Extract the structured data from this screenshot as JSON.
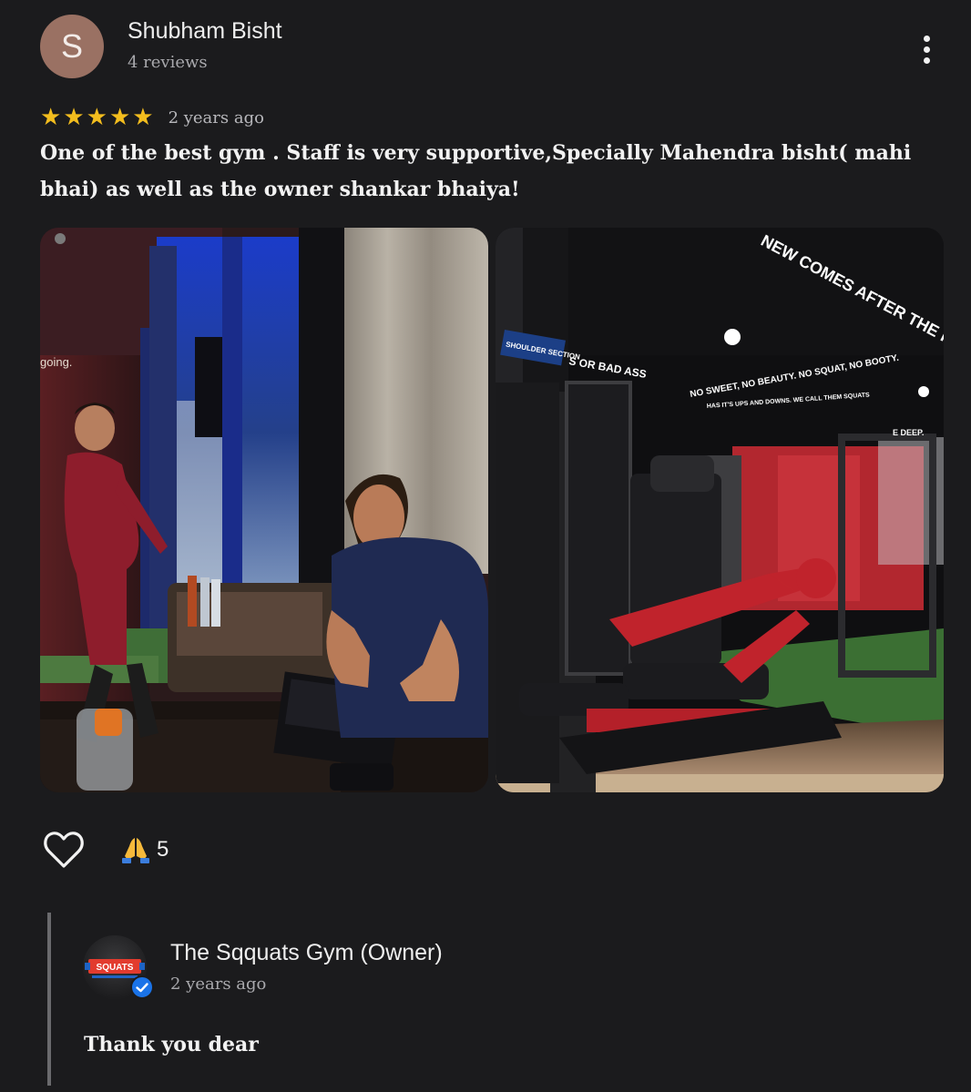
{
  "review": {
    "avatar_initial": "S",
    "avatar_color": "#9a7163",
    "reviewer_name": "Shubham Bisht",
    "reviewer_meta": "4 reviews",
    "rating": 5,
    "date": "2 years ago",
    "text": "One of the best gym .   Staff is very supportive,Specially Mahendra bisht( mahi bhai) as well as the owner shankar bhaiya!",
    "menu_icon": "more-vert-icon"
  },
  "photos": {
    "left": {
      "wall_text": "going."
    },
    "right": {
      "wall_slogan": "NEW COMES AFTER THE HARDEST CLI",
      "shoulder_sign": "SHOULDER SECTION",
      "beam_text_left": "S OR BAD ASS",
      "beam_text_main": "NO SWEET, NO BEAUTY. NO SQUAT, NO BOOTY.",
      "beam_text_small": "HAS IT'S UPS AND DOWNS. WE CALL THEM SQUATS",
      "beam_text_right": "E DEEP."
    }
  },
  "reactions": {
    "like_icon": "heart-outline-icon",
    "pray_icon": "folded-hands-icon",
    "count": "5"
  },
  "owner_reply": {
    "name": "The Sqquats Gym (Owner)",
    "date": "2 years ago",
    "text": "Thank you dear",
    "logo_text": "SQUATS",
    "verified_icon": "verified-check-icon",
    "verified_color": "#1a73e8"
  },
  "colors": {
    "background": "#1b1b1d",
    "star": "#f3bd1e",
    "reply_line": "#6a6a6d"
  }
}
